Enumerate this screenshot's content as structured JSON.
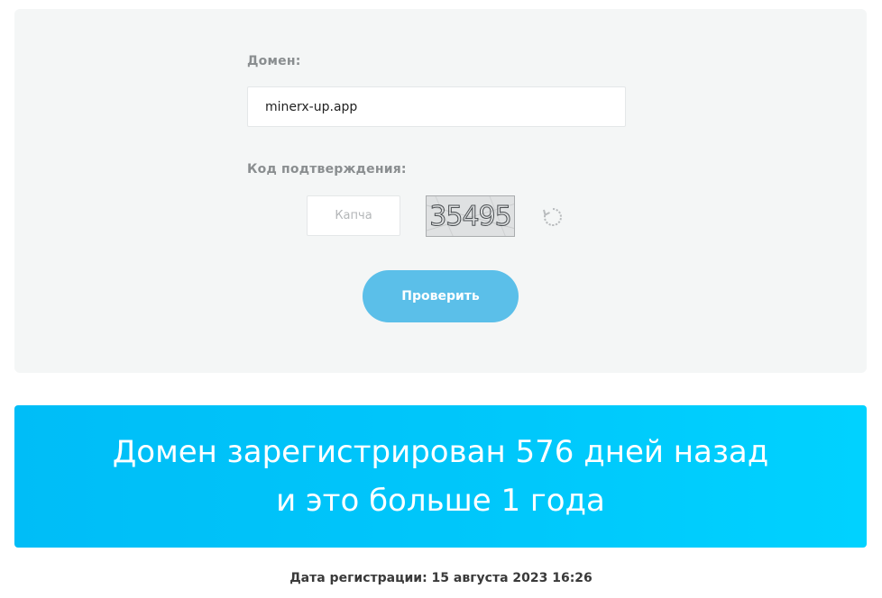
{
  "form": {
    "domain_label": "Домен:",
    "domain_value": "minerx-up.app",
    "captcha_label": "Код подтверждения:",
    "captcha_placeholder": "Капча",
    "captcha_code": "35495",
    "refresh_icon": "refresh-icon",
    "check_button_label": "Проверить"
  },
  "result": {
    "line1": "Домен зарегистрирован 576 дней назад",
    "line2": "и это больше 1 года"
  },
  "registration": {
    "text": "Дата регистрации: 15 августа 2023 16:26"
  },
  "colors": {
    "banner": "#00c8fb",
    "button": "#5bbfe9",
    "card_background": "#f4f6f6"
  }
}
